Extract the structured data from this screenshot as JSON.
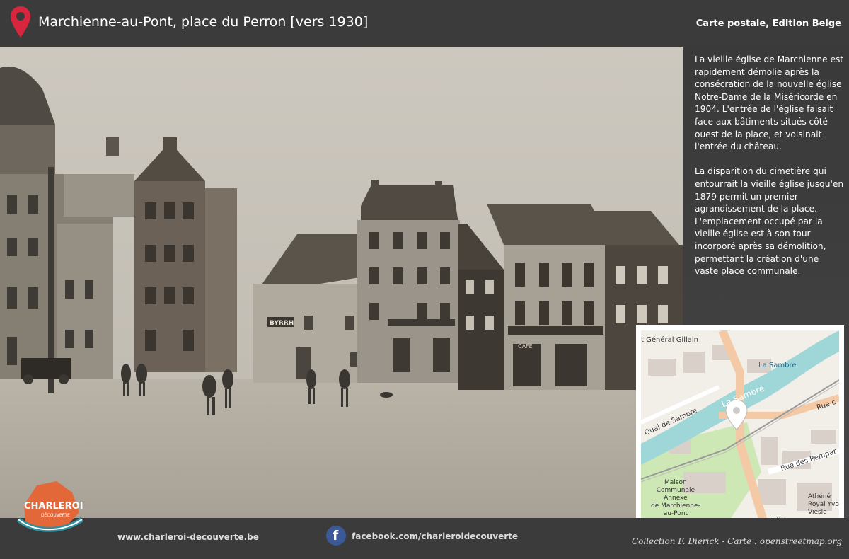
{
  "header": {
    "title": "Marchienne-au-Pont, place du Perron [vers 1930]",
    "source": "Carte postale, Edition Belge"
  },
  "description": {
    "paragraph_1": "La vieille église de Marchienne est rapidement démolie après la consécration de la nouvelle église Notre-Dame de la Miséricorde en 1904. L'entrée de l'église faisait face aux bâtiments situés côté ouest de la place, et voisinait l'entrée du château.",
    "paragraph_2": "La disparition du cimetière qui entourrait la vieille église jusqu'en 1879 permit un premier agrandissement de la place. L'emplacement occupé par la vieille église est à son tour incorporé après sa démolition, permettant la création d'une vaste place communale."
  },
  "photo": {
    "signs": {
      "byrrh": "BYRRH",
      "cafe": "CAFE"
    }
  },
  "map": {
    "labels": {
      "street_gillain": "t Général Gillain",
      "river_1": "La Sambre",
      "river_2": "La Sambre",
      "quai": "Quai de Sambre",
      "rue_right": "Rue c",
      "rue_remparts": "Rue des Rempar",
      "maison_line1": "Maison",
      "maison_line2": "Communale",
      "maison_line3": "Annexe",
      "maison_line4": "de Marchienne-",
      "maison_line5": "au-Pont",
      "athenee_line1": "Athéné",
      "athenee_line2": "Royal Yvo",
      "athenee_line3": "Viesle",
      "ru": "Ru"
    }
  },
  "footer": {
    "logo_text_1": "CHARLEROI",
    "logo_text_2": "DÉCOUVERTE",
    "website": "www.charleroi-decouverte.be",
    "fb_letter": "f",
    "facebook": "facebook.com/charleroidecouverte",
    "credit": "Collection F. Dierick - Carte : openstreetmap.org"
  },
  "colors": {
    "header_bg": "#3b3b3b",
    "pin_red": "#d7263d",
    "river": "#9fd6d8",
    "facebook_blue": "#3b5998",
    "logo_orange": "#e2683a",
    "logo_teal": "#2f8f9d"
  }
}
